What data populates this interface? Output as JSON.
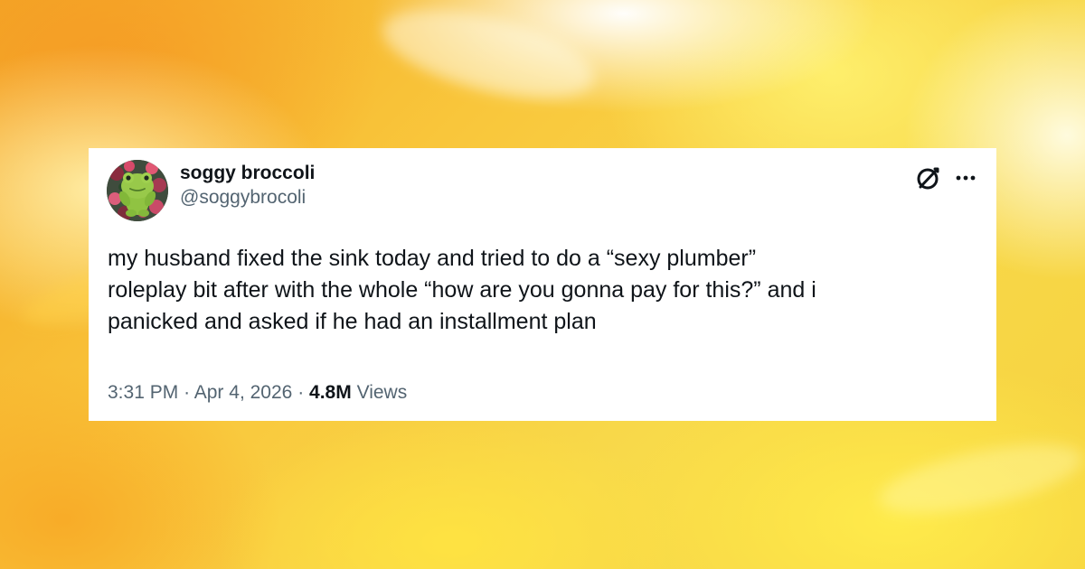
{
  "tweet": {
    "display_name": "soggy broccoli",
    "handle": "@soggybrocoli",
    "text": "my husband fixed the sink today and tried to do a “sexy plumber”\nroleplay bit after with the whole “how are you gonna pay for this?” and i\npanicked and asked if he had an installment plan",
    "time": "3:31 PM",
    "date": "Apr 4, 2026",
    "separator": "·",
    "views_count": "4.8M",
    "views_label": "Views"
  },
  "icons": {
    "grok": "grok-icon",
    "more": "more-dots-icon"
  },
  "colors": {
    "card_background": "#ffffff",
    "primary_text": "#0f1419",
    "secondary_text": "#536471"
  }
}
